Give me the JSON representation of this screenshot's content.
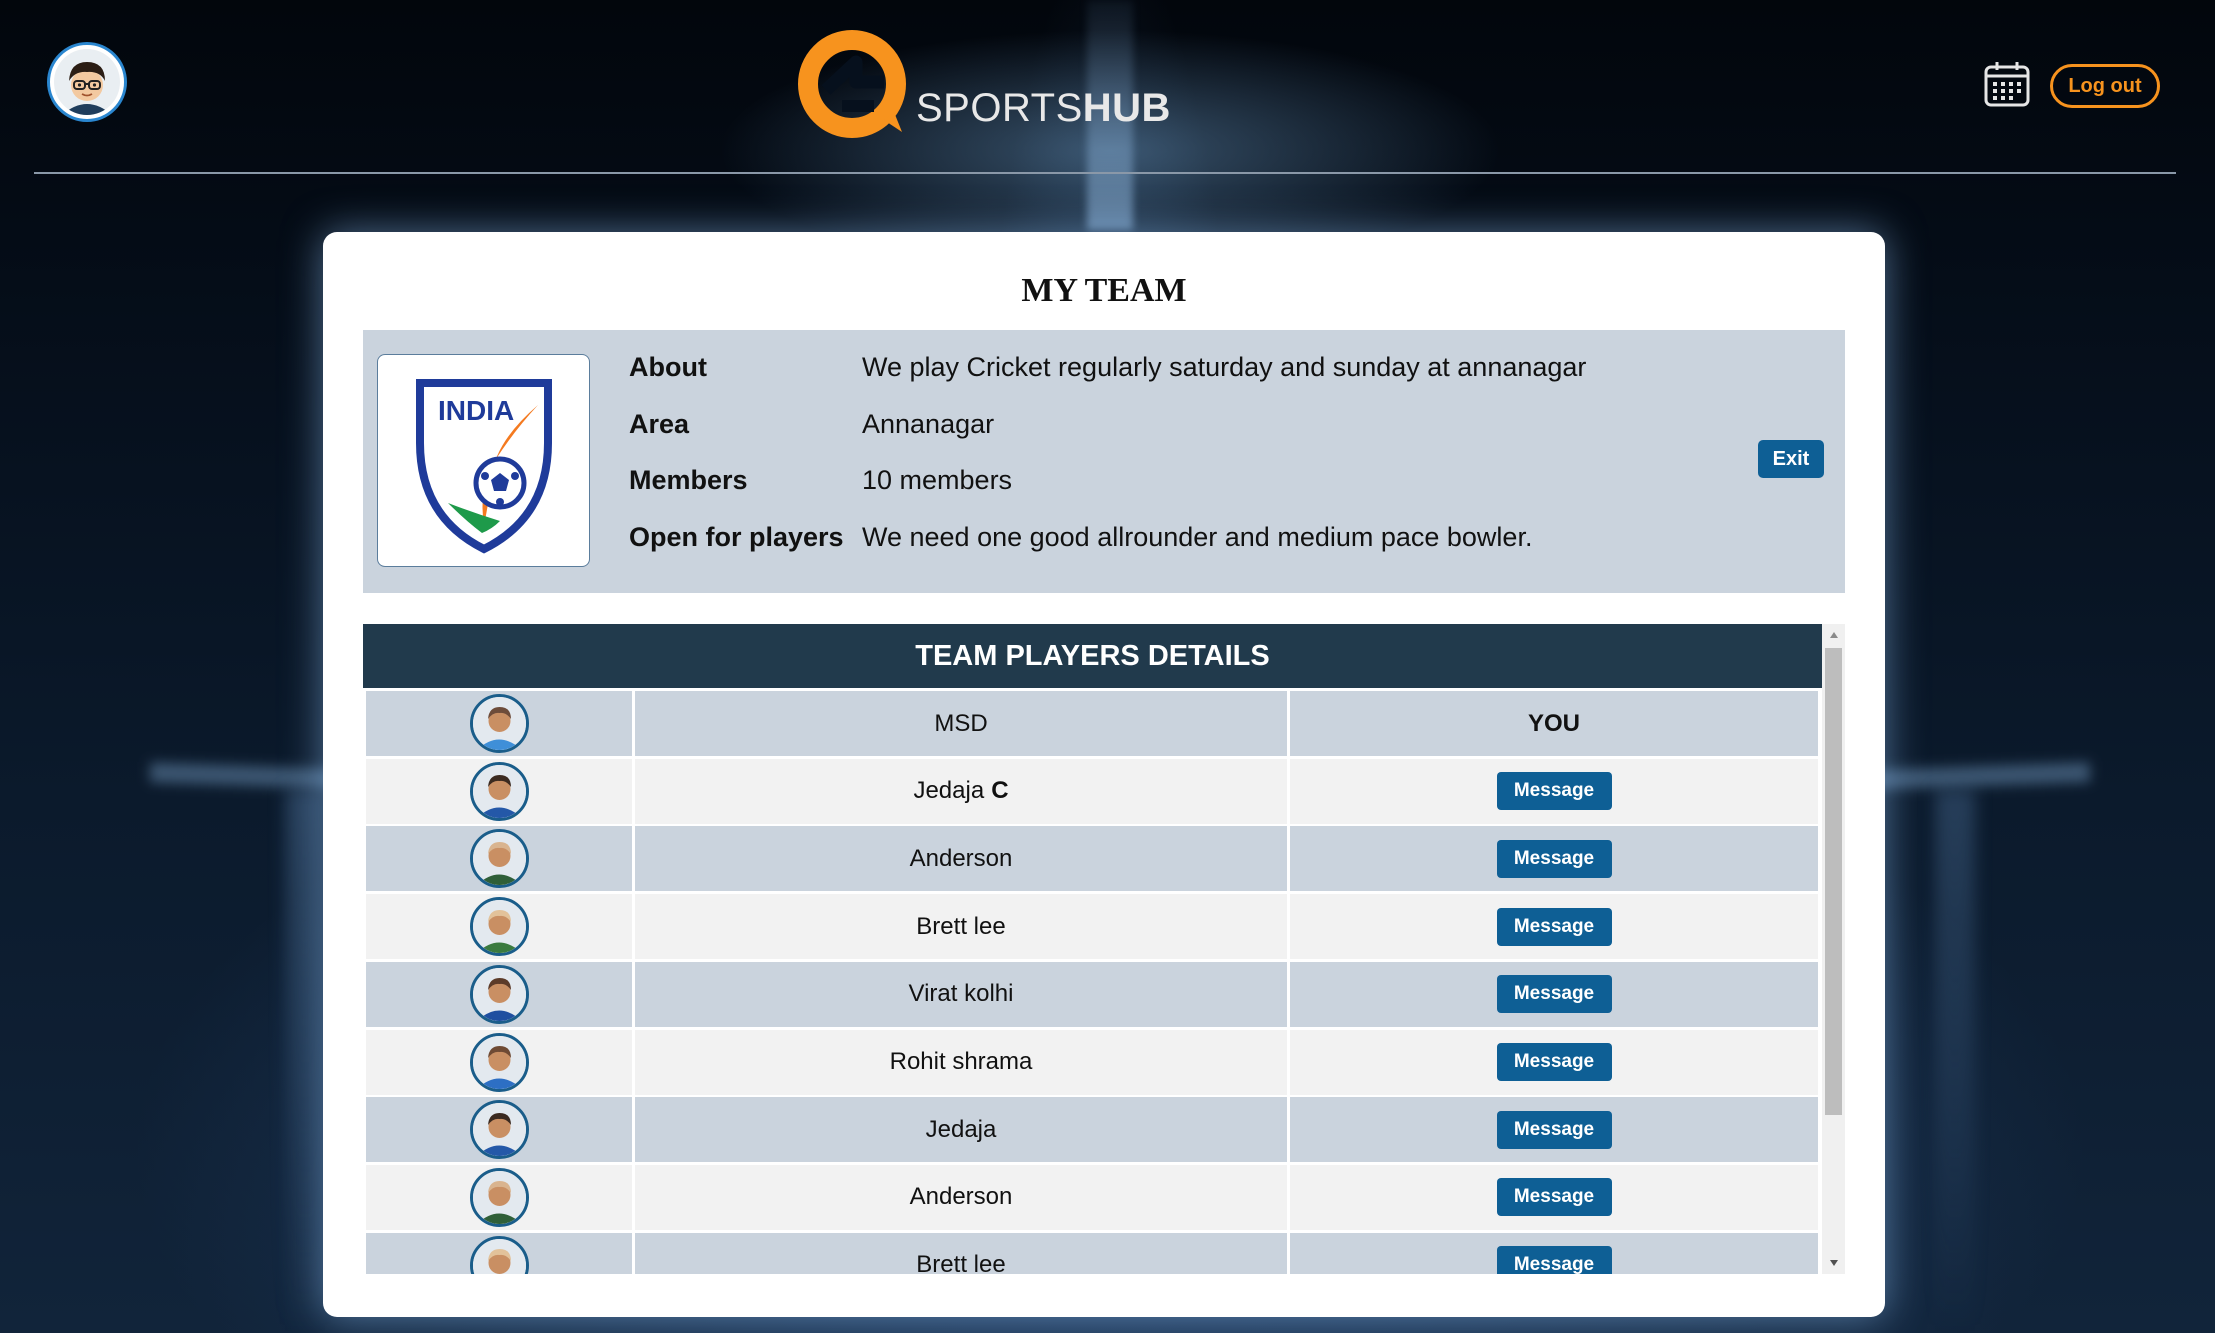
{
  "header": {
    "logo_text_light": "SPORTS",
    "logo_text_bold": "HUB",
    "logout_label": "Log out",
    "icons": {
      "avatar": "user-avatar",
      "calendar": "calendar-icon"
    },
    "colors": {
      "accent": "#f7931e",
      "primary_button": "#0e5f95",
      "table_header": "#213a4c"
    }
  },
  "team": {
    "title": "MY TEAM",
    "logo_text": "INDIA",
    "exit_label": "Exit",
    "details": [
      {
        "label": "About",
        "value": "We play Cricket regularly saturday and sunday at annanagar"
      },
      {
        "label": "Area",
        "value": "Annanagar"
      },
      {
        "label": "Members",
        "value": "10 members"
      },
      {
        "label": "Open for players",
        "value": "We need one good allrounder and medium pace bowler."
      }
    ]
  },
  "players": {
    "title": "TEAM PLAYERS DETAILS",
    "rows": [
      {
        "name": "MSD",
        "action": "YOU"
      },
      {
        "name": "Jedaja",
        "badge": "C",
        "action": "Message"
      },
      {
        "name": "Anderson",
        "action": "Message"
      },
      {
        "name": "Brett lee",
        "action": "Message"
      },
      {
        "name": "Virat kolhi",
        "action": "Message"
      },
      {
        "name": "Rohit shrama",
        "action": "Message"
      },
      {
        "name": "Jedaja",
        "action": "Message"
      },
      {
        "name": "Anderson",
        "action": "Message"
      },
      {
        "name": "Brett lee",
        "action": "Message"
      }
    ]
  }
}
